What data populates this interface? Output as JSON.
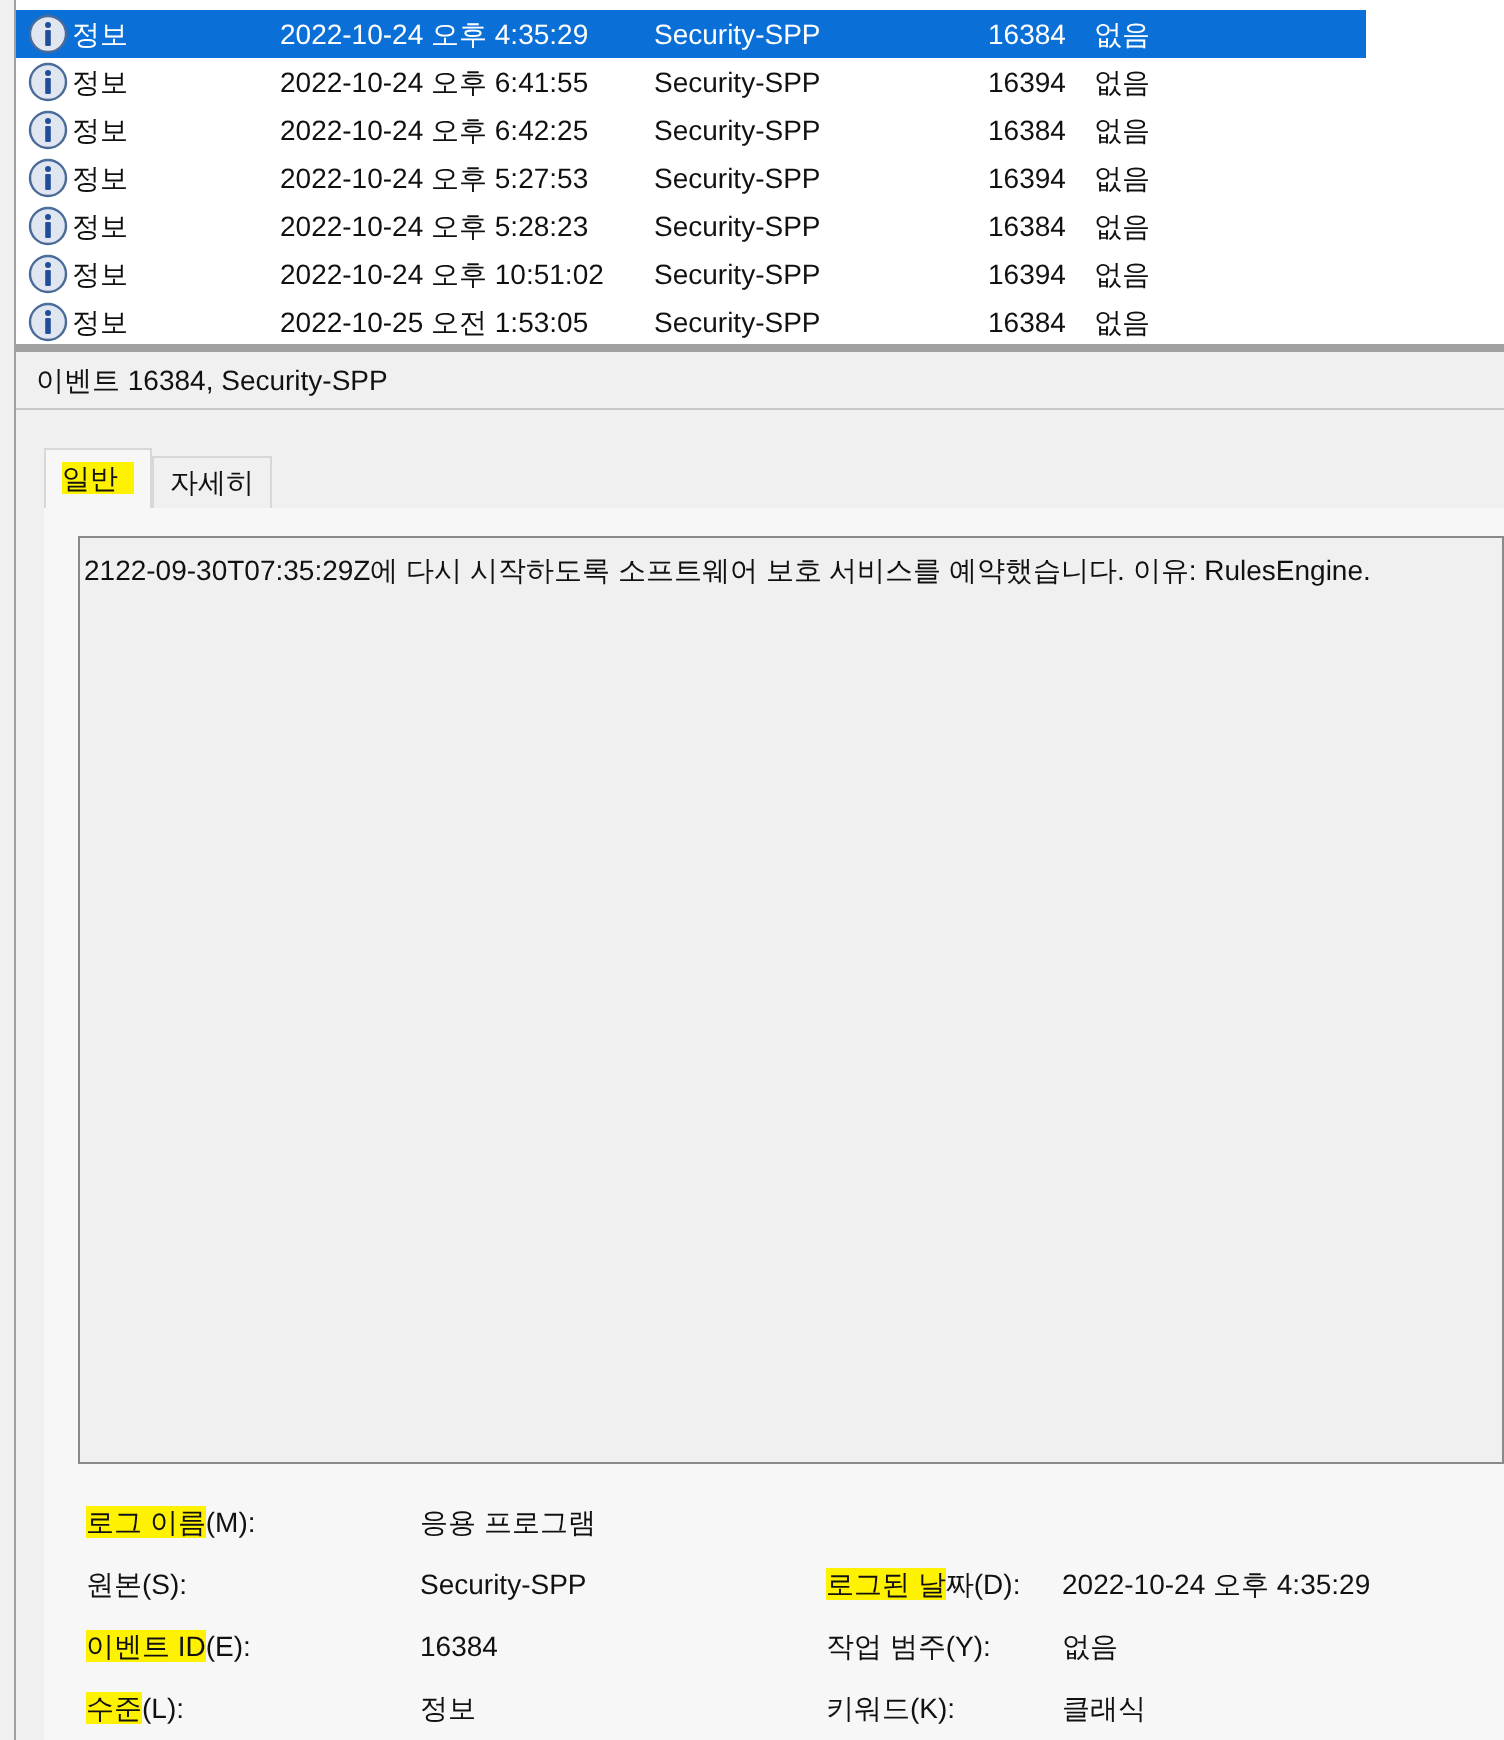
{
  "event_list": {
    "rows": [
      {
        "level": "정보",
        "date": "2022-10-24 오후 4:35:29",
        "source": "Security-SPP",
        "event_id": "16384",
        "category": "없음",
        "selected": true
      },
      {
        "level": "정보",
        "date": "2022-10-24 오후 6:41:55",
        "source": "Security-SPP",
        "event_id": "16394",
        "category": "없음",
        "selected": false
      },
      {
        "level": "정보",
        "date": "2022-10-24 오후 6:42:25",
        "source": "Security-SPP",
        "event_id": "16384",
        "category": "없음",
        "selected": false
      },
      {
        "level": "정보",
        "date": "2022-10-24 오후 5:27:53",
        "source": "Security-SPP",
        "event_id": "16394",
        "category": "없음",
        "selected": false
      },
      {
        "level": "정보",
        "date": "2022-10-24 오후 5:28:23",
        "source": "Security-SPP",
        "event_id": "16384",
        "category": "없음",
        "selected": false
      },
      {
        "level": "정보",
        "date": "2022-10-24 오후 10:51:02",
        "source": "Security-SPP",
        "event_id": "16394",
        "category": "없음",
        "selected": false
      },
      {
        "level": "정보",
        "date": "2022-10-25 오전 1:53:05",
        "source": "Security-SPP",
        "event_id": "16384",
        "category": "없음",
        "selected": false
      }
    ]
  },
  "detail": {
    "title": "이벤트 16384, Security-SPP",
    "tabs": [
      {
        "label": "일반",
        "selected": true,
        "highlighted": true
      },
      {
        "label": "자세히",
        "selected": false,
        "highlighted": false
      }
    ],
    "message": "2122-09-30T07:35:29Z에 다시 시작하도록 소프트웨어 보호 서비스를 예약했습니다. 이유: RulesEngine.",
    "fields": [
      {
        "label": {
          "highlighted": "로그 이름",
          "plain": "(M):"
        },
        "value": "응용 프로그램"
      },
      {
        "label": {
          "plain": "원본(S):"
        },
        "value": "Security-SPP"
      },
      {
        "label": {
          "highlighted": "로그된 날",
          "plain": "짜(D):"
        },
        "value": "2022-10-24 오후 4:35:29"
      },
      {
        "label": {
          "highlighted": "이벤트 ID",
          "plain": "(E):"
        },
        "value": "16384"
      },
      {
        "label": {
          "plain": "작업 범주(Y):"
        },
        "value": "없음"
      },
      {
        "label": {
          "highlighted": "수준",
          "plain": "(L):"
        },
        "value": "정보"
      },
      {
        "label": {
          "plain": "키워드(K):"
        },
        "value": "클래식"
      }
    ]
  }
}
